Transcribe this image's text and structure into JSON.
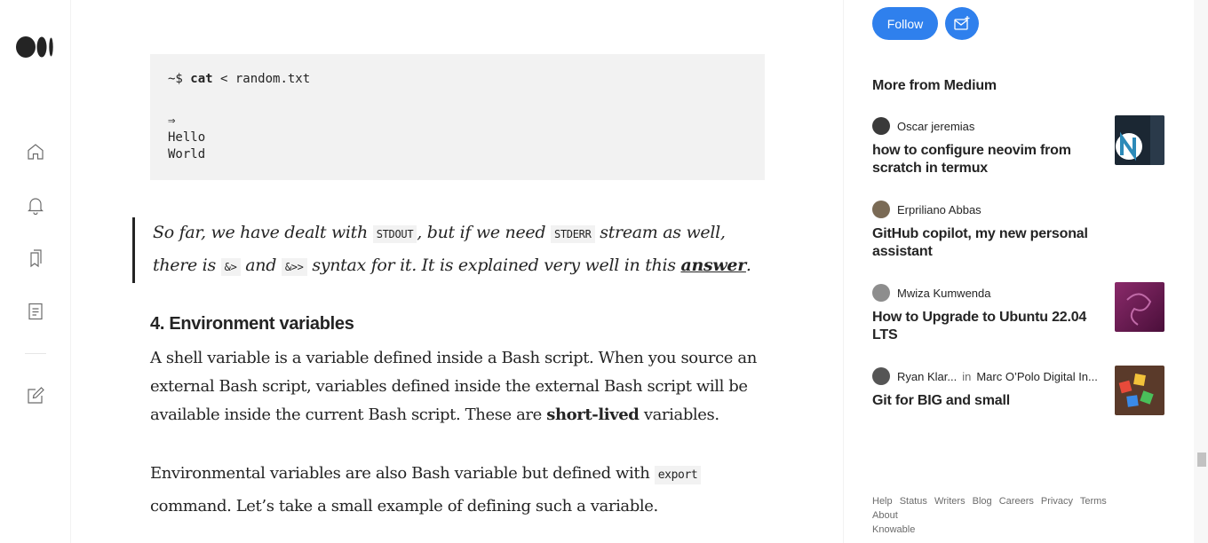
{
  "colors": {
    "accent": "#2f80ed",
    "text": "#242424",
    "muted": "#6b6b6b",
    "code_bg": "#f2f2f2"
  },
  "rail": {
    "icons": [
      "medium-logo",
      "home-icon",
      "bell-icon",
      "bookmarks-icon",
      "stories-icon",
      "write-icon"
    ]
  },
  "article": {
    "code": {
      "prompt": "~$ ",
      "cmd": "cat",
      "rest": " < random.txt",
      "arrow": "⇒",
      "out1": "Hello",
      "out2": "World"
    },
    "quote": {
      "t1": "So far, we have dealt with ",
      "c1": "STDOUT",
      "t2": ", but if we need ",
      "c2": "STDERR",
      "t3": " stream as well, there is ",
      "c3": "&>",
      "t4": " and ",
      "c4": "&>>",
      "t5": " syntax for it. It is explained very well in this ",
      "link": "answer",
      "t6": "."
    },
    "heading": "4. Environment variables",
    "p1": {
      "a": "A shell variable is a variable defined inside a Bash script. When you source an external Bash script, variables defined inside the external Bash script will be available inside the current Bash script. These are ",
      "b": "short-lived",
      "c": " variables."
    },
    "p2": {
      "a": "Environmental variables are also Bash variable but defined with ",
      "code": "export",
      "b": " command. Let’s take a small example of defining such a variable."
    }
  },
  "sidebar": {
    "follow_label": "Follow",
    "more_title": "More from Medium",
    "recs": [
      {
        "author": "Oscar jeremias",
        "pub": "",
        "title": "how to configure neovim from scratch in termux",
        "avatar_color": "#3a3a3a",
        "thumb": "neovim"
      },
      {
        "author": "Erpriliano Abbas",
        "pub": "",
        "title": "GitHub copilot, my new personal assistant",
        "avatar_color": "#7a6a55",
        "thumb": ""
      },
      {
        "author": "Mwiza Kumwenda",
        "pub": "",
        "title": "How to Upgrade to Ubuntu 22.04 LTS",
        "avatar_color": "#8d8d8d",
        "thumb": "ubuntu"
      },
      {
        "author": "Ryan Klar...",
        "in": "in",
        "pub": "Marc O’Polo Digital In...",
        "title": "Git for BIG and small",
        "avatar_color": "#555555",
        "thumb": "git"
      }
    ],
    "footer": [
      "Help",
      "Status",
      "Writers",
      "Blog",
      "Careers",
      "Privacy",
      "Terms",
      "About",
      "Knowable"
    ]
  }
}
